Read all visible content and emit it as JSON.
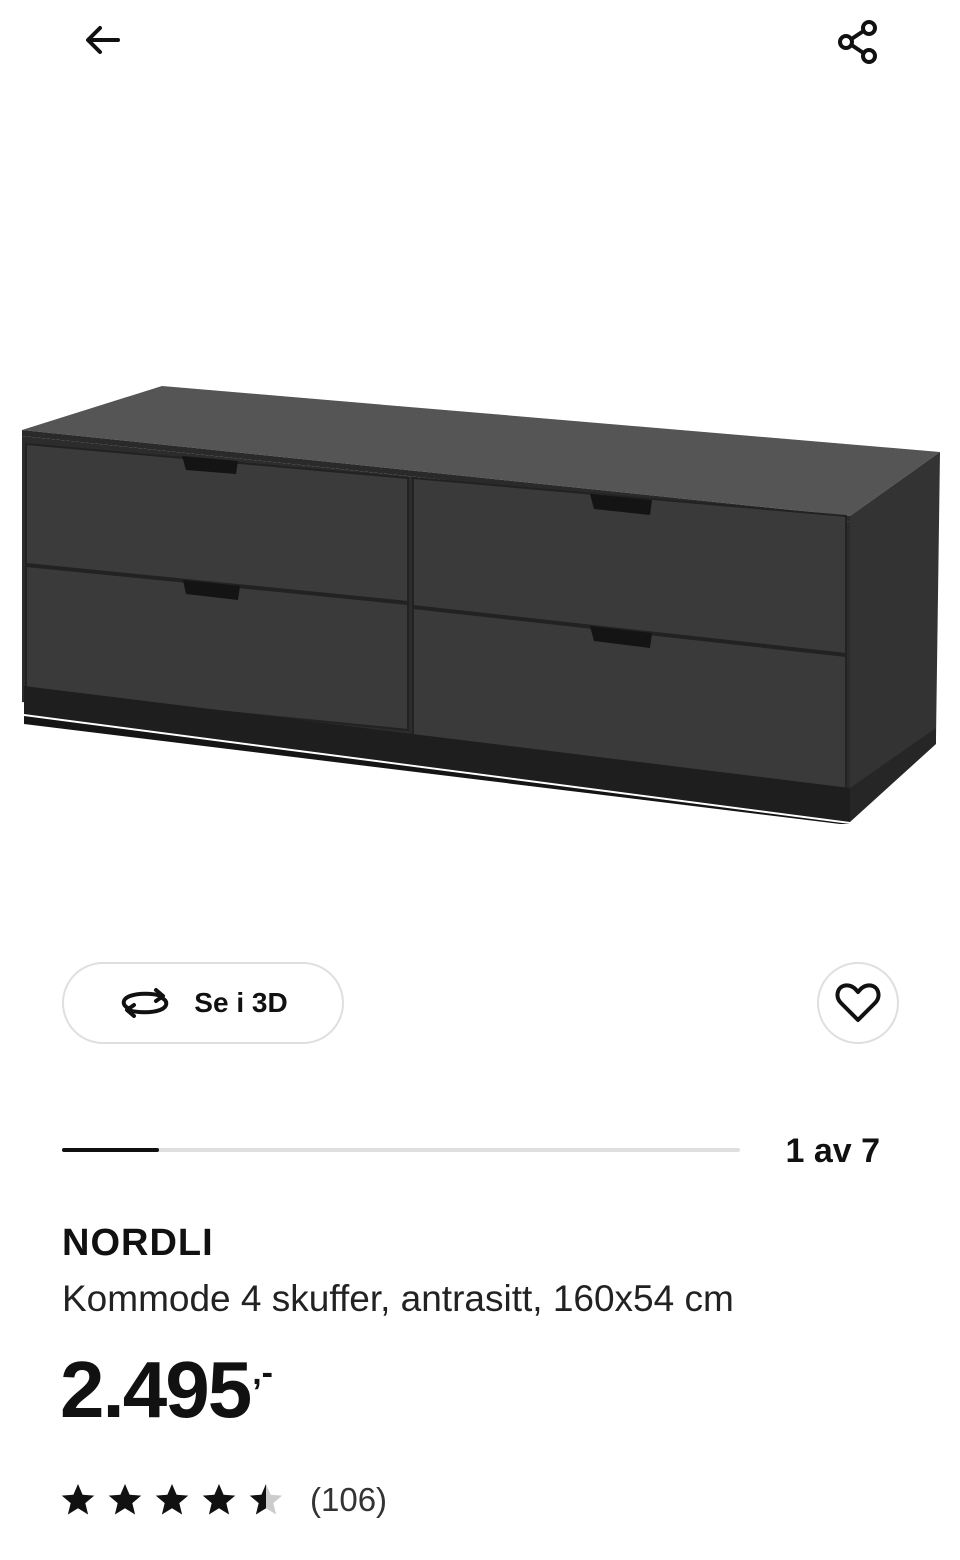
{
  "header": {
    "back_icon": "arrow-left-icon",
    "share_icon": "share-icon"
  },
  "product_image": {
    "subject": "product-photo",
    "color": "#3a3a3a"
  },
  "actions": {
    "view3d_label": "Se i 3D",
    "view3d_icon": "rotate-3d-icon",
    "favorite_icon": "heart-icon"
  },
  "gallery": {
    "counter": "1 av 7",
    "current": 1,
    "total": 7
  },
  "product": {
    "name": "NORDLI",
    "description": "Kommode 4 skuffer, antrasitt, 160x54 cm",
    "price": "2.495",
    "price_suffix": ",-"
  },
  "rating": {
    "value": 4.5,
    "max": 5,
    "count_label": "(106)",
    "icon": "star-icon"
  },
  "colors": {
    "text": "#111111",
    "border": "#dfdfdf",
    "star": "#111111",
    "star_empty": "#cccccc"
  }
}
